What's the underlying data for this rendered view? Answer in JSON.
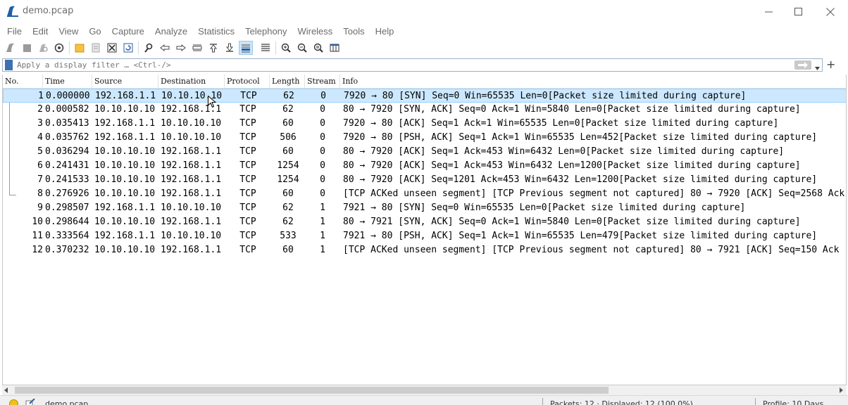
{
  "window": {
    "title": "demo.pcap",
    "accent": "#1f5fa8"
  },
  "menu": [
    "File",
    "Edit",
    "View",
    "Go",
    "Capture",
    "Analyze",
    "Statistics",
    "Telephony",
    "Wireless",
    "Tools",
    "Help"
  ],
  "toolbar_icons": [
    "shark-fin-icon",
    "stop-icon",
    "restart-icon",
    "gear-icon",
    "open-folder-icon",
    "file-icon",
    "close-file-icon",
    "reload-icon",
    "search-icon",
    "back-arrow-icon",
    "forward-arrow-icon",
    "goto-packet-icon",
    "first-packet-icon",
    "last-packet-icon",
    "autoscroll-icon",
    "colorize-icon",
    "zoom-in-icon",
    "zoom-out-icon",
    "zoom-reset-icon",
    "resize-columns-icon"
  ],
  "filter": {
    "placeholder": "Apply a display filter … <Ctrl-/>",
    "add_label": "+"
  },
  "columns": [
    "No.",
    "Time",
    "Source",
    "Destination",
    "Protocol",
    "Length",
    "Stream",
    "Info"
  ],
  "packets": [
    {
      "no": "1",
      "time": "0.000000",
      "src": "192.168.1.1",
      "dst": "10.10.10.10",
      "proto": "TCP",
      "len": "62",
      "stream": "0",
      "info": "7920 → 80 [SYN] Seq=0 Win=65535 Len=0[Packet size limited during capture]"
    },
    {
      "no": "2",
      "time": "0.000582",
      "src": "10.10.10.10",
      "dst": "192.168.1.1",
      "proto": "TCP",
      "len": "62",
      "stream": "0",
      "info": "80 → 7920 [SYN, ACK] Seq=0 Ack=1 Win=5840 Len=0[Packet size limited during capture]"
    },
    {
      "no": "3",
      "time": "0.035413",
      "src": "192.168.1.1",
      "dst": "10.10.10.10",
      "proto": "TCP",
      "len": "60",
      "stream": "0",
      "info": "7920 → 80 [ACK] Seq=1 Ack=1 Win=65535 Len=0[Packet size limited during capture]"
    },
    {
      "no": "4",
      "time": "0.035762",
      "src": "192.168.1.1",
      "dst": "10.10.10.10",
      "proto": "TCP",
      "len": "506",
      "stream": "0",
      "info": "7920 → 80 [PSH, ACK] Seq=1 Ack=1 Win=65535 Len=452[Packet size limited during capture]"
    },
    {
      "no": "5",
      "time": "0.036294",
      "src": "10.10.10.10",
      "dst": "192.168.1.1",
      "proto": "TCP",
      "len": "60",
      "stream": "0",
      "info": "80 → 7920 [ACK] Seq=1 Ack=453 Win=6432 Len=0[Packet size limited during capture]"
    },
    {
      "no": "6",
      "time": "0.241431",
      "src": "10.10.10.10",
      "dst": "192.168.1.1",
      "proto": "TCP",
      "len": "1254",
      "stream": "0",
      "info": "80 → 7920 [ACK] Seq=1 Ack=453 Win=6432 Len=1200[Packet size limited during capture]"
    },
    {
      "no": "7",
      "time": "0.241533",
      "src": "10.10.10.10",
      "dst": "192.168.1.1",
      "proto": "TCP",
      "len": "1254",
      "stream": "0",
      "info": "80 → 7920 [ACK] Seq=1201 Ack=453 Win=6432 Len=1200[Packet size limited during capture]"
    },
    {
      "no": "8",
      "time": "0.276926",
      "src": "10.10.10.10",
      "dst": "192.168.1.1",
      "proto": "TCP",
      "len": "60",
      "stream": "0",
      "info": "[TCP ACKed unseen segment] [TCP Previous segment not captured] 80 → 7920 [ACK] Seq=2568 Ack"
    },
    {
      "no": "9",
      "time": "0.298507",
      "src": "192.168.1.1",
      "dst": "10.10.10.10",
      "proto": "TCP",
      "len": "62",
      "stream": "1",
      "info": "7921 → 80 [SYN] Seq=0 Win=65535 Len=0[Packet size limited during capture]"
    },
    {
      "no": "10",
      "time": "0.298644",
      "src": "10.10.10.10",
      "dst": "192.168.1.1",
      "proto": "TCP",
      "len": "62",
      "stream": "1",
      "info": "80 → 7921 [SYN, ACK] Seq=0 Ack=1 Win=5840 Len=0[Packet size limited during capture]"
    },
    {
      "no": "11",
      "time": "0.333564",
      "src": "192.168.1.1",
      "dst": "10.10.10.10",
      "proto": "TCP",
      "len": "533",
      "stream": "1",
      "info": "7921 → 80 [PSH, ACK] Seq=1 Ack=1 Win=65535 Len=479[Packet size limited during capture]"
    },
    {
      "no": "12",
      "time": "0.370232",
      "src": "10.10.10.10",
      "dst": "192.168.1.1",
      "proto": "TCP",
      "len": "60",
      "stream": "1",
      "info": "[TCP ACKed unseen segment] [TCP Previous segment not captured] 80 → 7921 [ACK] Seq=150 Ack"
    }
  ],
  "selected_row": "1",
  "status": {
    "file": "demo.pcap",
    "packets": "Packets: 12 · Displayed: 12 (100.0%)",
    "profile": "Profile: 10 Days"
  },
  "colors": {
    "selected_bg": "#cce8ff",
    "selected_border": "#99d1ff",
    "status_dot": "#f1c21b"
  }
}
